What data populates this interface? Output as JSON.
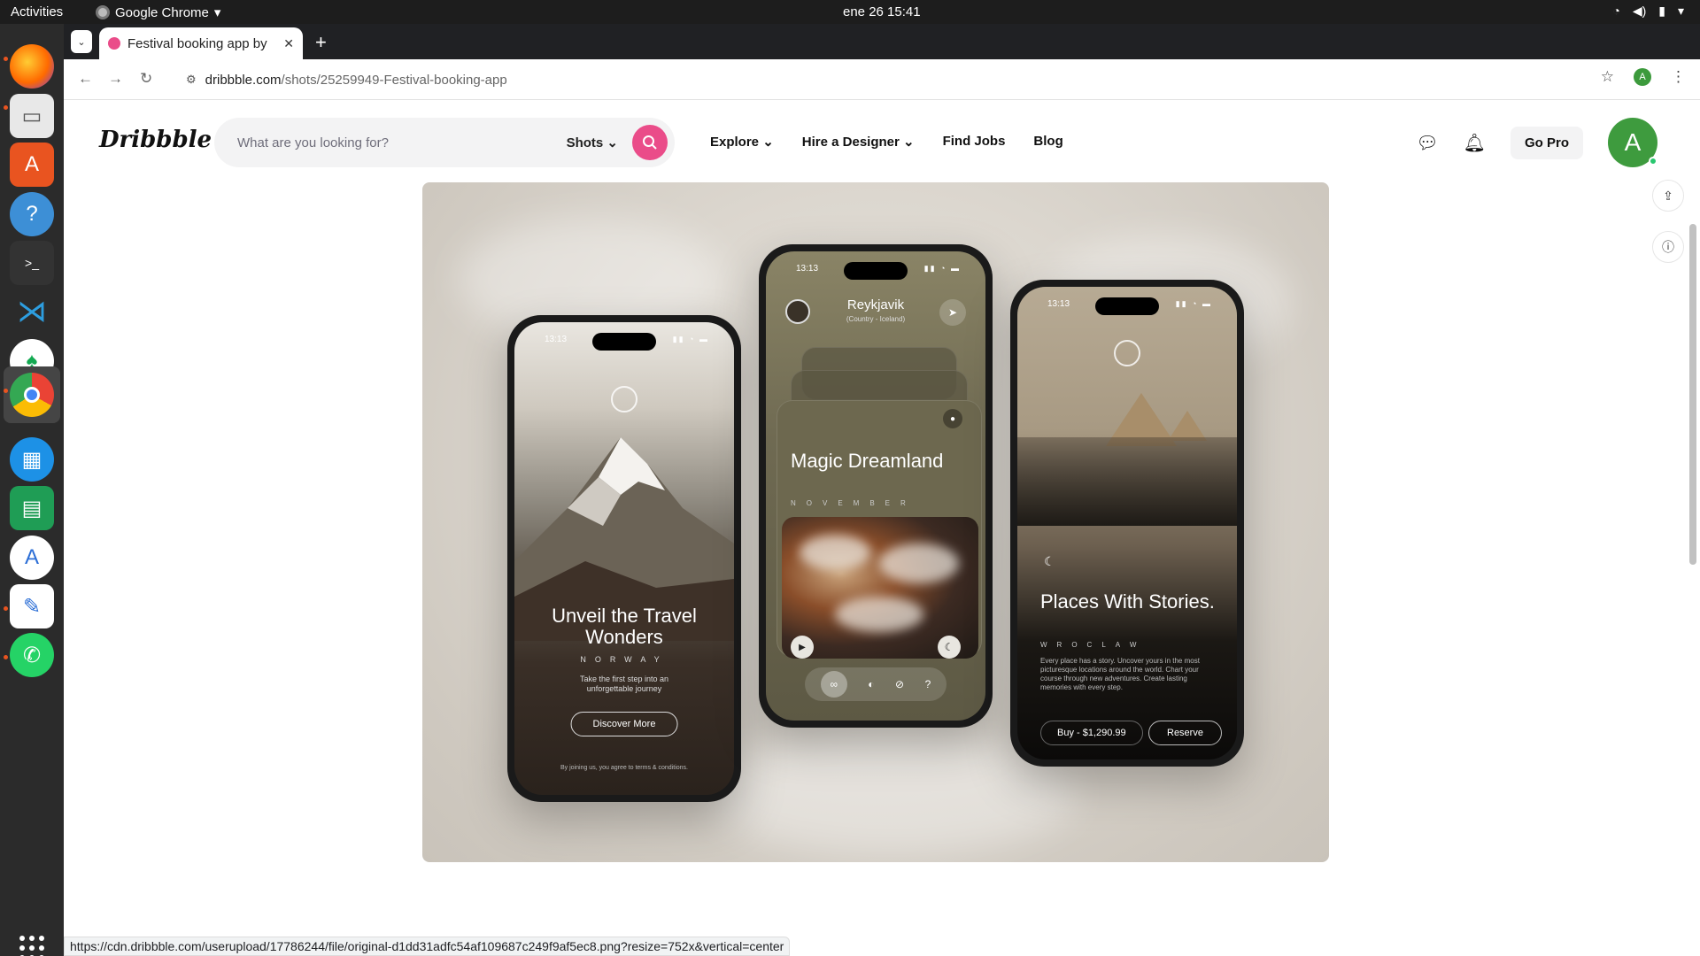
{
  "system_bar": {
    "activities": "Activities",
    "app_name": "Google Chrome",
    "clock": "ene 26  15:41"
  },
  "dock": {
    "items": [
      "firefox-icon",
      "files-icon",
      "app-center-icon",
      "help-icon",
      "terminal-icon",
      "vscode-icon",
      "mongodb-compass-icon",
      "chrome-icon",
      "docker-icon",
      "spreadsheet-icon",
      "software-updater-icon",
      "text-editor-icon",
      "whatsapp-icon"
    ]
  },
  "browser": {
    "tab_title": "Festival booking app by",
    "url_host": "dribbble.com",
    "url_path": "/shots/25259949-Festival-booking-app",
    "profile_initial": "A"
  },
  "header": {
    "logo": "Dribbble",
    "search_placeholder": "What are you looking for?",
    "search_scope": "Shots",
    "nav": [
      "Explore",
      "Hire a Designer",
      "Find Jobs",
      "Blog"
    ],
    "go_pro": "Go Pro",
    "avatar_initial": "A"
  },
  "shot": {
    "phone1": {
      "time": "13:13",
      "title": "Unveil the Travel Wonders",
      "location": "NORWAY",
      "subtitle": "Take the first step into an unforgettable journey",
      "button": "Discover More",
      "terms": "By joining us, you agree to terms & conditions."
    },
    "phone2": {
      "time": "13:13",
      "city": "Reykjavik",
      "country": "(Country - Iceland)",
      "title": "Magic Dreamland",
      "month": "NOVEMBER"
    },
    "phone3": {
      "time": "13:13",
      "title": "Places With Stories.",
      "location": "WROCLAW",
      "description": "Every place has a story. Uncover yours in the most picturesque locations around the world. Chart your course through new adventures. Create lasting memories with every step.",
      "buy": "Buy - $1,290.99",
      "reserve": "Reserve"
    }
  },
  "status_url": "https://cdn.dribbble.com/userupload/17786244/file/original-d1dd31adfc54af109687c249f9af5ec8.png?resize=752x&vertical=center",
  "colors": {
    "accent": "#ea4c89",
    "avatar": "#3e9b3e"
  }
}
